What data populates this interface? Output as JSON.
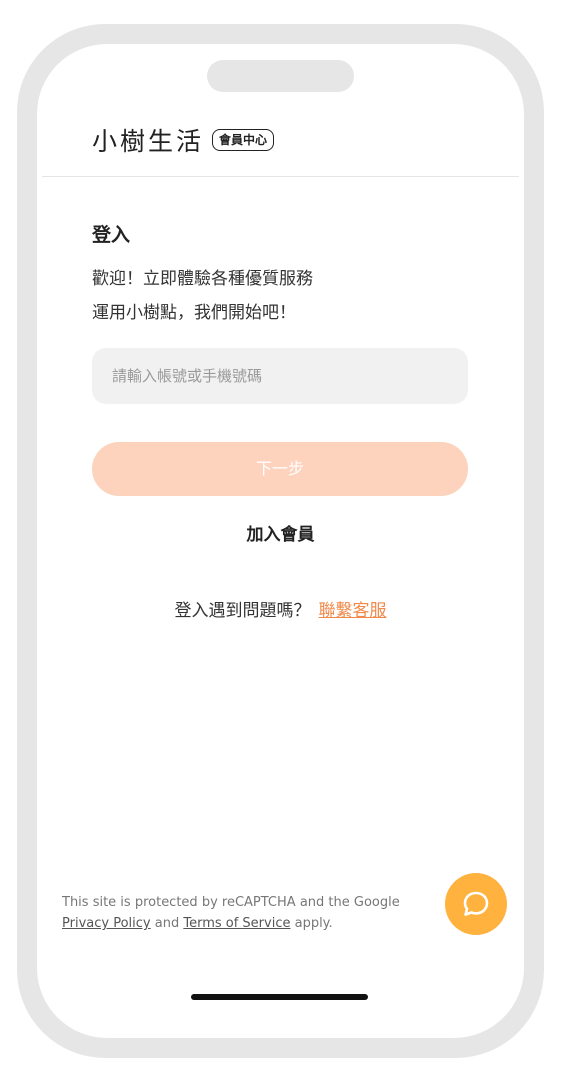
{
  "header": {
    "brand": "小樹生活",
    "badge": "會員中心"
  },
  "login": {
    "title": "登入",
    "subtitle_line1": "歡迎！立即體驗各種優質服務",
    "subtitle_line2": "運用小樹點，我們開始吧！",
    "input_placeholder": "請輸入帳號或手機號碼",
    "input_value": "",
    "next_label": "下一步",
    "join_label": "加入會員",
    "help_text": "登入遇到問題嗎？",
    "help_link": "聯繫客服"
  },
  "recaptcha": {
    "text1": "This site is protected by reCAPTCHA and the Google ",
    "privacy_link": "Privacy Policy",
    "text2": " and ",
    "terms_link": "Terms of Service",
    "text3": " apply."
  },
  "colors": {
    "accent": "#f08a4b",
    "button_disabled": "#fdd3bd",
    "chat_button": "#ffb23e"
  },
  "icons": {
    "chat": "chat-bubble-icon"
  }
}
